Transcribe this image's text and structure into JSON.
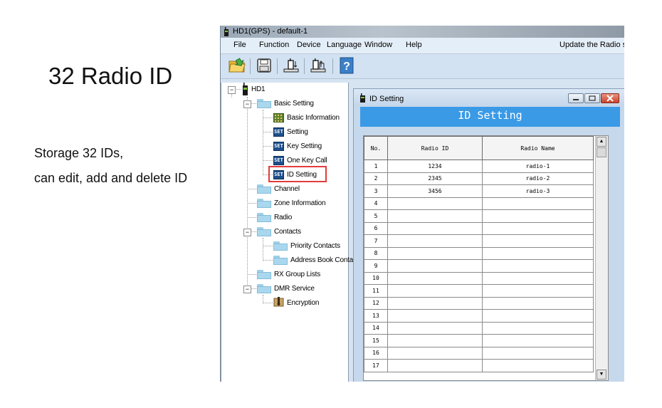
{
  "promo": {
    "title": "32 Radio ID",
    "line1": "Storage 32 IDs,",
    "line2": "can edit, add and delete ID"
  },
  "app": {
    "window_title": "HD1(GPS)  -  default-1",
    "menu": [
      "File",
      "Function",
      "Device",
      "Language",
      "Window",
      "Help"
    ],
    "menu_right": "Update the Radio s",
    "toolbar_icons": [
      "open-folder-icon",
      "save-icon",
      "read-from-radio-icon",
      "write-to-radio-icon",
      "help-icon"
    ]
  },
  "tree": {
    "root": "HD1",
    "basic_setting": "Basic Setting",
    "basic_information": "Basic Information",
    "setting": "Setting",
    "key_setting": "Key Setting",
    "one_key_call": "One Key Call",
    "id_setting": "ID Setting",
    "channel": "Channel",
    "zone_information": "Zone Information",
    "radio": "Radio",
    "contacts": "Contacts",
    "priority_contacts": "Priority Contacts",
    "address_book": "Address Book Conta",
    "rx_group_lists": "RX Group Lists",
    "dmr_service": "DMR Service",
    "encryption": "Encryption",
    "set_icon_text": "SET"
  },
  "id_window": {
    "title": "ID Setting",
    "banner": "ID Setting",
    "columns": [
      "No.",
      "Radio ID",
      "Radio Name"
    ],
    "rows": [
      {
        "no": "1",
        "id": "1234",
        "name": "radio-1"
      },
      {
        "no": "2",
        "id": "2345",
        "name": "radio-2"
      },
      {
        "no": "3",
        "id": "3456",
        "name": "radio-3"
      },
      {
        "no": "4",
        "id": "",
        "name": ""
      },
      {
        "no": "5",
        "id": "",
        "name": ""
      },
      {
        "no": "6",
        "id": "",
        "name": ""
      },
      {
        "no": "7",
        "id": "",
        "name": ""
      },
      {
        "no": "8",
        "id": "",
        "name": ""
      },
      {
        "no": "9",
        "id": "",
        "name": ""
      },
      {
        "no": "10",
        "id": "",
        "name": ""
      },
      {
        "no": "11",
        "id": "",
        "name": ""
      },
      {
        "no": "12",
        "id": "",
        "name": ""
      },
      {
        "no": "13",
        "id": "",
        "name": ""
      },
      {
        "no": "14",
        "id": "",
        "name": ""
      },
      {
        "no": "15",
        "id": "",
        "name": ""
      },
      {
        "no": "16",
        "id": "",
        "name": ""
      },
      {
        "no": "17",
        "id": "",
        "name": ""
      }
    ]
  },
  "colors": {
    "banner": "#3a9ae6",
    "highlight": "#e33b3b"
  }
}
